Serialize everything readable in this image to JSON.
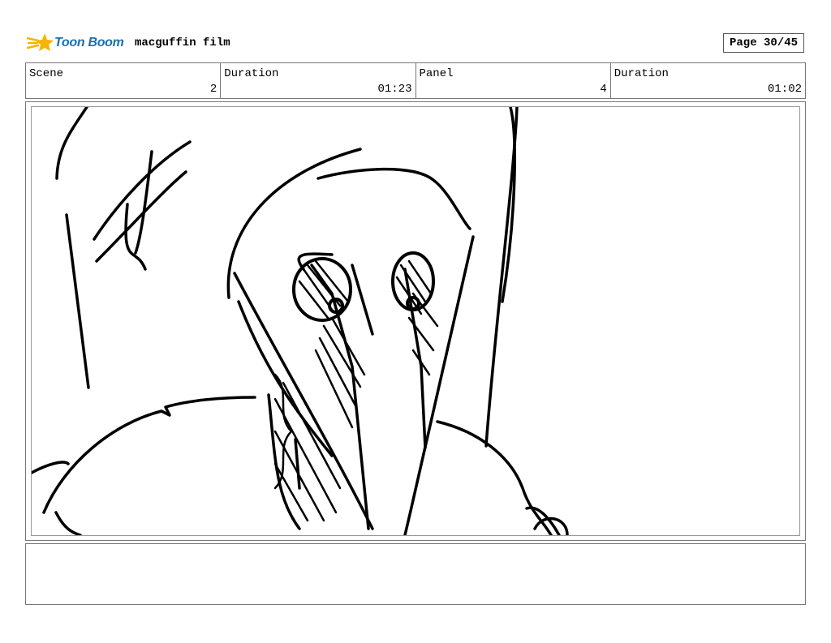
{
  "header": {
    "logo_alt": "Toon Boom",
    "logo_text": "Toon Boom",
    "project_title": "macguffin film",
    "page_label": "Page 30/45"
  },
  "info": {
    "scene_label": "Scene",
    "scene_value": "2",
    "scene_duration_label": "Duration",
    "scene_duration_value": "01:23",
    "panel_label": "Panel",
    "panel_value": "4",
    "panel_duration_label": "Duration",
    "panel_duration_value": "01:02"
  },
  "notes": {
    "text": ""
  },
  "colors": {
    "brand_blue": "#1a6fb3",
    "brand_yellow": "#f5b400",
    "border": "#777777"
  }
}
